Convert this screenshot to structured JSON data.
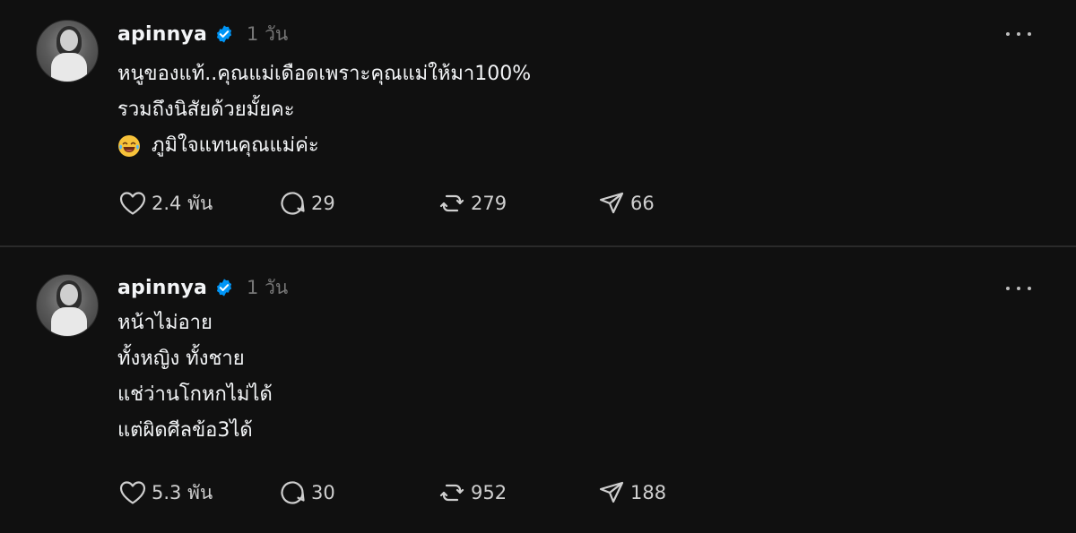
{
  "posts": [
    {
      "username": "apinnya",
      "timestamp": "1 วัน",
      "lines": [
        "หนูของแท้..คุณแม่เดือดเพราะคุณแม่ให้มา100%",
        "รวมถึงนิสัยด้วยมั้ยคะ",
        "ภูมิใจแทนคุณแม่ค่ะ"
      ],
      "emoji": "face-with-tears-of-joy",
      "likes": "2.4 พัน",
      "comments": "29",
      "reposts": "279",
      "shares": "66"
    },
    {
      "username": "apinnya",
      "timestamp": "1 วัน",
      "lines": [
        "หน้าไม่อาย",
        "ทั้งหญิง ทั้งชาย",
        "แช่ว่านโกหกไม่ได้",
        "แต่ผิดศีลข้อ3ได้"
      ],
      "likes": "5.3 พัน",
      "comments": "30",
      "reposts": "952",
      "shares": "188"
    }
  ],
  "colors": {
    "background": "#101010",
    "text": "#f3f5f7",
    "muted": "#777777",
    "verified": "#0095f6"
  },
  "icons": {
    "verified": "verified-badge-icon",
    "more": "more-options-icon",
    "like": "heart-icon",
    "comment": "comment-bubble-icon",
    "repost": "repost-icon",
    "share": "send-icon"
  }
}
